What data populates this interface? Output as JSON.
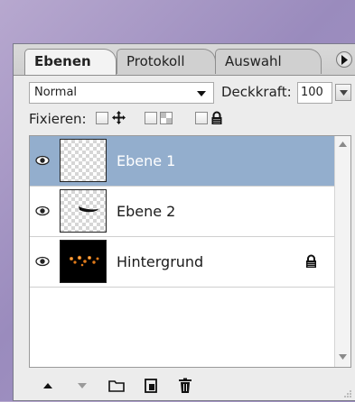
{
  "tabs": [
    {
      "label": "Ebenen",
      "active": true
    },
    {
      "label": "Protokoll",
      "active": false
    },
    {
      "label": "Auswahl",
      "active": false
    }
  ],
  "panel_menu_icon": "flyout-menu-icon",
  "blend_mode": {
    "value": "Normal",
    "icon": "chevron-down-icon"
  },
  "opacity": {
    "label": "Deckkraft:",
    "value": "100",
    "icon": "arrow-down-icon"
  },
  "lock": {
    "label": "Fixieren:",
    "options": [
      {
        "icon": "move-icon"
      },
      {
        "icon": "transparency-lock-icon"
      },
      {
        "icon": "lock-icon"
      }
    ]
  },
  "layers": [
    {
      "name": "Ebene 1",
      "selected": true,
      "visible_icon": "eye-icon",
      "thumbnail": "transparent"
    },
    {
      "name": "Ebene 2",
      "selected": false,
      "visible_icon": "eye-icon",
      "thumbnail": "brush-stroke"
    },
    {
      "name": "Hintergrund",
      "selected": false,
      "visible_icon": "eye-icon",
      "thumbnail": "dark-lights",
      "locked": true
    }
  ],
  "toolbar": [
    {
      "icon": "move-layer-up-icon"
    },
    {
      "icon": "move-layer-down-icon"
    },
    {
      "icon": "new-folder-icon"
    },
    {
      "icon": "new-layer-icon"
    },
    {
      "icon": "trash-icon"
    }
  ],
  "colors": {
    "selection": "#93aecd",
    "panel": "#ececec",
    "background": "#a99bc9"
  }
}
